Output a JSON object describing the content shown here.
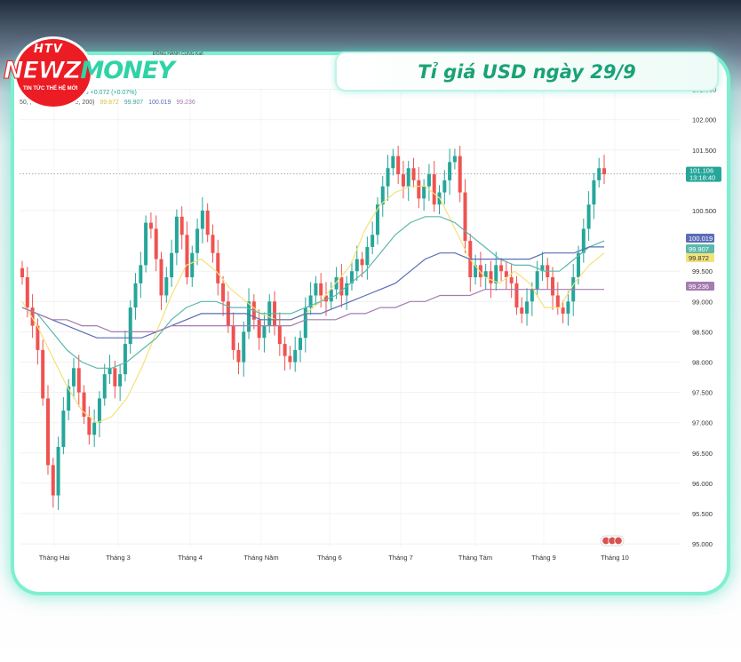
{
  "title": "Tỉ giá USD ngày 29/9",
  "logo": {
    "htv": "HTV",
    "word_left": "NEWZ",
    "word_right": "MONEY",
    "tagline": "TIN TỨC THẾ HỆ MỚI",
    "partner": "ĐỒNG HÀNH CÙNG Kafi"
  },
  "legend": {
    "row1": "106  +0.072 (+0.07%)",
    "row2_prefix": "50,  , 100, SMA, close, 200)",
    "row2_values": [
      "99.872",
      "99.907",
      "100.019",
      "99.236"
    ]
  },
  "colors": {
    "up": "#26a69a",
    "down": "#ef5350",
    "sma_short": "#f3e27a",
    "sma_mid": "#5bb8ad",
    "sma_long": "#5a6db5",
    "sma_200": "#a57bb0",
    "price_badge": "#26a69a"
  },
  "chart_data": {
    "type": "line",
    "title": "",
    "xlabel": "",
    "ylabel": "",
    "ylim": [
      94.9,
      102.6
    ],
    "x_ticks": [
      "Tháng Hai",
      "Tháng 3",
      "Tháng 4",
      "Tháng Năm",
      "Tháng 6",
      "Tháng 7",
      "Tháng Tám",
      "Tháng 9",
      "Tháng 10"
    ],
    "y_ticks": [
      "95.000",
      "95.500",
      "96.000",
      "96.500",
      "97.000",
      "97.500",
      "98.000",
      "98.500",
      "99.000",
      "99.500",
      "100.500",
      "101.500",
      "102.000",
      "102.500"
    ],
    "last_price": {
      "value": 101.106,
      "label": "101.106",
      "countdown": "13:18:40"
    },
    "sma_badges": [
      {
        "label": "100.019",
        "value": 100.019,
        "color": "#5a6db5"
      },
      {
        "label": "99.907",
        "value": 99.907,
        "color": "#5bb8ad"
      },
      {
        "label": "99.872",
        "value": 99.872,
        "color": "#f3e27a"
      },
      {
        "label": "99.236",
        "value": 99.236,
        "color": "#a57bb0"
      }
    ],
    "price_series": {
      "name": "",
      "values": [
        99.4,
        98.9,
        98.6,
        98.2,
        97.4,
        96.3,
        95.8,
        96.6,
        97.2,
        97.6,
        97.9,
        97.5,
        97.1,
        96.8,
        97.0,
        97.4,
        97.8,
        97.9,
        97.6,
        97.8,
        98.3,
        98.9,
        99.3,
        99.6,
        100.3,
        100.2,
        99.7,
        99.1,
        99.4,
        99.8,
        100.4,
        100.1,
        99.4,
        99.8,
        100.2,
        100.5,
        100.1,
        99.8,
        99.3,
        99.0,
        98.6,
        98.2,
        98.0,
        98.5,
        99.0,
        98.7,
        98.4,
        98.6,
        99.0,
        98.6,
        98.3,
        98.1,
        98.0,
        98.2,
        98.4,
        98.9,
        99.1,
        99.3,
        99.1,
        99.0,
        99.2,
        99.4,
        99.1,
        99.3,
        99.5,
        99.7,
        99.6,
        99.9,
        100.1,
        100.6,
        100.9,
        101.2,
        101.4,
        101.1,
        100.9,
        101.2,
        101.0,
        100.7,
        100.9,
        101.1,
        100.6,
        100.8,
        101.0,
        101.3,
        101.4,
        100.8,
        100.0,
        99.4,
        99.6,
        99.4,
        99.5,
        99.3,
        99.6,
        99.5,
        99.4,
        99.3,
        98.9,
        98.8,
        99.0,
        99.2,
        99.5,
        99.6,
        99.4,
        99.1,
        98.9,
        98.8,
        99.0,
        99.4,
        99.8,
        100.2,
        100.6,
        101.0,
        101.2,
        101.1
      ]
    },
    "series": [
      {
        "name": "",
        "color": "#f3e27a",
        "values": [
          99.0,
          98.6,
          98.1,
          97.6,
          97.2,
          97.0,
          97.1,
          97.4,
          97.9,
          98.5,
          99.1,
          99.6,
          99.7,
          99.5,
          99.2,
          99.0,
          98.8,
          98.7,
          98.7,
          98.8,
          99.0,
          99.3,
          99.6,
          100.2,
          100.6,
          100.8,
          100.9,
          100.9,
          100.7,
          100.2,
          99.7,
          99.4,
          99.3,
          99.5,
          99.3,
          98.9,
          98.9,
          99.3,
          99.6,
          99.8
        ]
      },
      {
        "name": "",
        "color": "#5bb8ad",
        "values": [
          98.9,
          98.8,
          98.5,
          98.2,
          98.0,
          97.9,
          97.9,
          98.0,
          98.2,
          98.4,
          98.7,
          98.9,
          99.0,
          99.0,
          98.9,
          98.9,
          98.8,
          98.8,
          98.8,
          98.9,
          99.0,
          99.1,
          99.3,
          99.5,
          99.8,
          100.1,
          100.3,
          100.4,
          100.4,
          100.3,
          100.1,
          99.9,
          99.7,
          99.6,
          99.6,
          99.5,
          99.5,
          99.7,
          99.9,
          100.0
        ]
      },
      {
        "name": "",
        "color": "#5a6db5",
        "values": [
          98.9,
          98.8,
          98.7,
          98.6,
          98.5,
          98.4,
          98.4,
          98.4,
          98.4,
          98.5,
          98.6,
          98.7,
          98.8,
          98.8,
          98.8,
          98.8,
          98.7,
          98.7,
          98.7,
          98.8,
          98.8,
          98.9,
          99.0,
          99.1,
          99.2,
          99.3,
          99.5,
          99.7,
          99.8,
          99.8,
          99.7,
          99.7,
          99.7,
          99.7,
          99.7,
          99.8,
          99.8,
          99.8,
          99.9,
          99.9
        ]
      },
      {
        "name": "",
        "color": "#a57bb0",
        "values": [
          98.9,
          98.8,
          98.7,
          98.7,
          98.6,
          98.6,
          98.5,
          98.5,
          98.5,
          98.5,
          98.6,
          98.6,
          98.6,
          98.6,
          98.6,
          98.6,
          98.6,
          98.6,
          98.6,
          98.7,
          98.7,
          98.7,
          98.8,
          98.8,
          98.9,
          98.9,
          99.0,
          99.0,
          99.1,
          99.1,
          99.1,
          99.2,
          99.2,
          99.2,
          99.2,
          99.2,
          99.2,
          99.2,
          99.2,
          99.2
        ]
      }
    ],
    "legend_position": "top-left",
    "grid": true
  }
}
